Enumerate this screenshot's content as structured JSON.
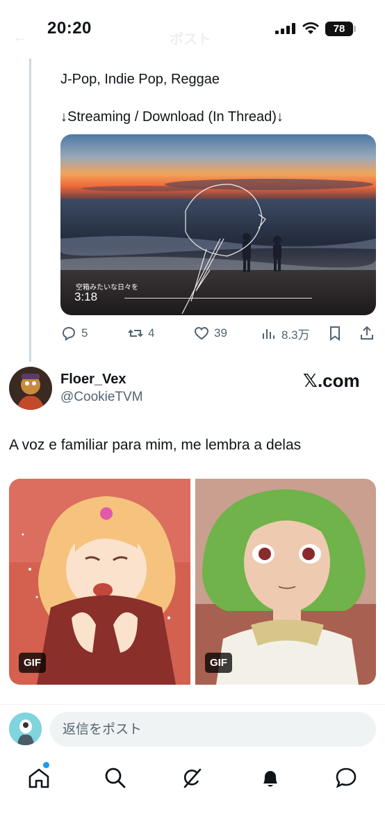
{
  "status_bar": {
    "time": "20:20",
    "battery": "78",
    "faded_header_title": "ポスト"
  },
  "previous_post": {
    "genres": "J-Pop, Indie Pop, Reggae",
    "streaming_note": "↓Streaming / Download (In Thread)↓",
    "video": {
      "caption": "空箱みたいな日々を",
      "duration": "3:18"
    },
    "actions": {
      "replies": "5",
      "reposts": "4",
      "likes": "39",
      "views": "8.3万"
    }
  },
  "post": {
    "author_name": "Floer_Vex",
    "author_handle": "@CookieTVM",
    "source_label": "𝕏.com",
    "text": "A voz e familiar para mim, me lembra a delas",
    "media": [
      {
        "badge": "GIF"
      },
      {
        "badge": "GIF"
      }
    ]
  },
  "reply": {
    "placeholder": "返信をポスト"
  },
  "nav": {
    "items": [
      "home-icon",
      "search-icon",
      "grok-icon",
      "notifications-icon",
      "messages-icon"
    ],
    "accent_color": "#1d9bf0"
  }
}
